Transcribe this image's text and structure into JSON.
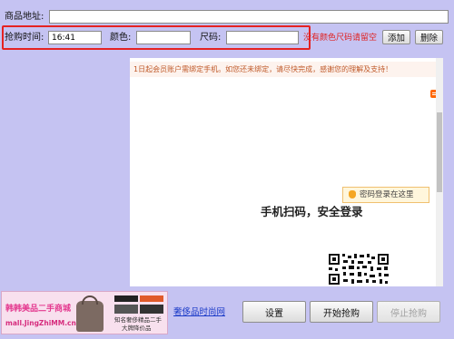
{
  "form": {
    "url_label": "商品地址:",
    "url_value": "",
    "time_label": "抢购时间:",
    "time_value": "16:41",
    "color_label": "颜色:",
    "color_value": "",
    "size_label": "尺码:",
    "size_value": "",
    "hint": "没有颜色尺码请留空",
    "add_button": "添加",
    "delete_button": "删除"
  },
  "browser": {
    "notice": "1日起会员账户需绑定手机。如您还未绑定，请尽快完成，感谢您的理解及支持！",
    "password_login_tip": "密码登录在这里",
    "scan_title": "手机扫码，安全登录"
  },
  "ad": {
    "shop_name": "韩韩美品二手商城",
    "shop_url": "mall.JingZhiMM.cn",
    "tagline1": "知名奢侈精品二手",
    "tagline2": "大牌降价品"
  },
  "footer": {
    "link_text": "奢侈品时尚网",
    "settings_button": "设置",
    "start_button": "开始抢购",
    "stop_button": "停止抢购"
  },
  "colors": {
    "background": "#c5c3f2",
    "highlight_red": "#e52222",
    "hint_red": "#e02020",
    "link_blue": "#1a3ac8",
    "accent_orange": "#ff6600"
  }
}
